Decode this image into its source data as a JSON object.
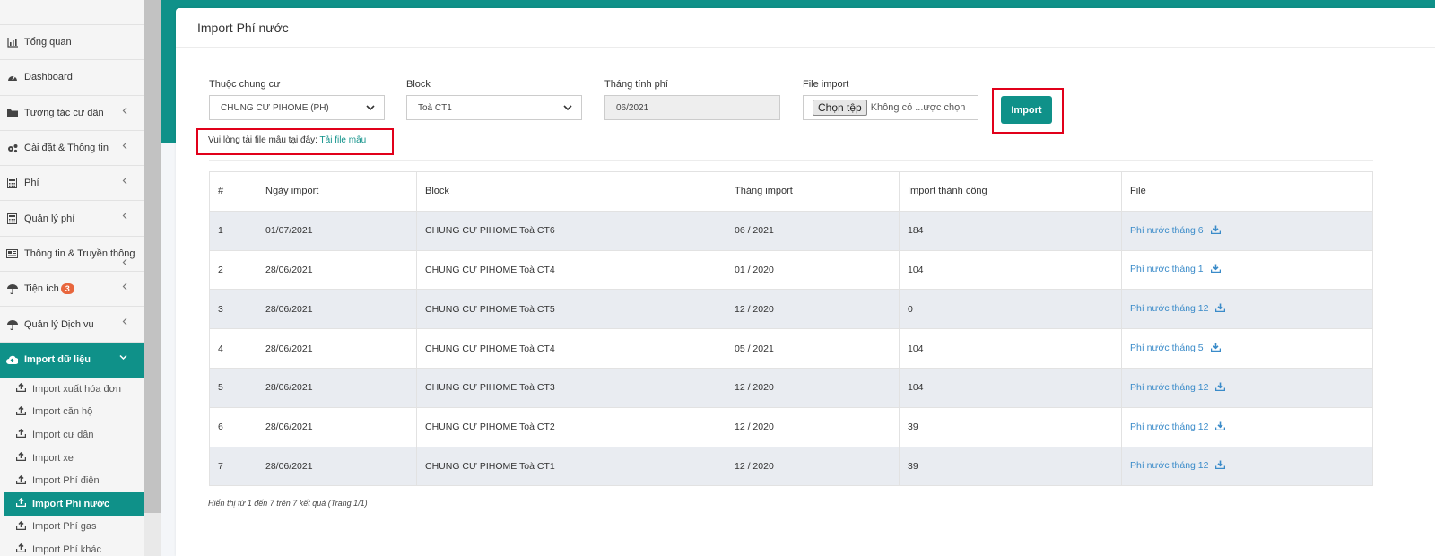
{
  "sidebar": {
    "items": [
      {
        "label": "Tổng quan",
        "icon": "bar-chart-icon",
        "chevron": false
      },
      {
        "label": "Dashboard",
        "icon": "dashboard-icon",
        "chevron": false
      },
      {
        "label": "Tương tác cư dân",
        "icon": "folder-icon",
        "chevron": true
      },
      {
        "label": "Cài đặt & Thông tin",
        "icon": "cogs-icon",
        "chevron": true
      },
      {
        "label": "Phí",
        "icon": "calculator-icon",
        "chevron": true
      },
      {
        "label": "Quản lý phí",
        "icon": "calculator-icon",
        "chevron": true
      },
      {
        "label": "Thông tin & Truyền thông",
        "icon": "newspaper-icon",
        "chevron": true
      },
      {
        "label": "Tiện ích",
        "icon": "umbrella-icon",
        "chevron": true,
        "badge": "3"
      },
      {
        "label": "Quản lý Dịch vụ",
        "icon": "umbrella-icon",
        "chevron": true
      },
      {
        "label": "Import dữ liệu",
        "icon": "cloud-upload-icon",
        "chevron": true,
        "active": true
      }
    ],
    "subitems": [
      {
        "label": "Import xuất hóa đơn"
      },
      {
        "label": "Import căn hộ"
      },
      {
        "label": "Import cư dân"
      },
      {
        "label": "Import xe"
      },
      {
        "label": "Import Phí điện"
      },
      {
        "label": "Import Phí nước",
        "active": true
      },
      {
        "label": "Import Phí gas"
      },
      {
        "label": "Import Phí khác"
      }
    ]
  },
  "page": {
    "title": "Import Phí nước"
  },
  "form": {
    "building_label": "Thuộc chung cư",
    "building_value": "CHUNG CƯ PIHOME (PH)",
    "block_label": "Block",
    "block_value": "Toà CT1",
    "month_label": "Tháng tính phí",
    "month_value": "06/2021",
    "file_label": "File import",
    "file_button": "Chọn tệp",
    "file_status": "Không có ...ược chọn",
    "import_button": "Import",
    "hint_text": "Vui lòng tải file mẫu tại đây: ",
    "hint_link": "Tải file mẫu"
  },
  "table": {
    "headers": [
      "#",
      "Ngày import",
      "Block",
      "Tháng import",
      "Import thành công",
      "File"
    ],
    "rows": [
      {
        "idx": "1",
        "date": "01/07/2021",
        "block": "CHUNG CƯ PIHOME Toà CT6",
        "month": "06 / 2021",
        "success": "184",
        "file": "Phí nước tháng 6"
      },
      {
        "idx": "2",
        "date": "28/06/2021",
        "block": "CHUNG CƯ PIHOME Toà CT4",
        "month": "01 / 2020",
        "success": "104",
        "file": "Phí nước tháng 1"
      },
      {
        "idx": "3",
        "date": "28/06/2021",
        "block": "CHUNG CƯ PIHOME Toà CT5",
        "month": "12 / 2020",
        "success": "0",
        "file": "Phí nước tháng 12"
      },
      {
        "idx": "4",
        "date": "28/06/2021",
        "block": "CHUNG CƯ PIHOME Toà CT4",
        "month": "05 / 2021",
        "success": "104",
        "file": "Phí nước tháng 5"
      },
      {
        "idx": "5",
        "date": "28/06/2021",
        "block": "CHUNG CƯ PIHOME Toà CT3",
        "month": "12 / 2020",
        "success": "104",
        "file": "Phí nước tháng 12"
      },
      {
        "idx": "6",
        "date": "28/06/2021",
        "block": "CHUNG CƯ PIHOME Toà CT2",
        "month": "12 / 2020",
        "success": "39",
        "file": "Phí nước tháng 12"
      },
      {
        "idx": "7",
        "date": "28/06/2021",
        "block": "CHUNG CƯ PIHOME Toà CT1",
        "month": "12 / 2020",
        "success": "39",
        "file": "Phí nước tháng 12"
      }
    ],
    "footer": "Hiển thị từ 1 đến 7 trên 7 kết quả (Trang 1/1)"
  },
  "colors": {
    "accent": "#0f9189",
    "highlight_box": "#e1001a",
    "link": "#3a8bc9"
  }
}
